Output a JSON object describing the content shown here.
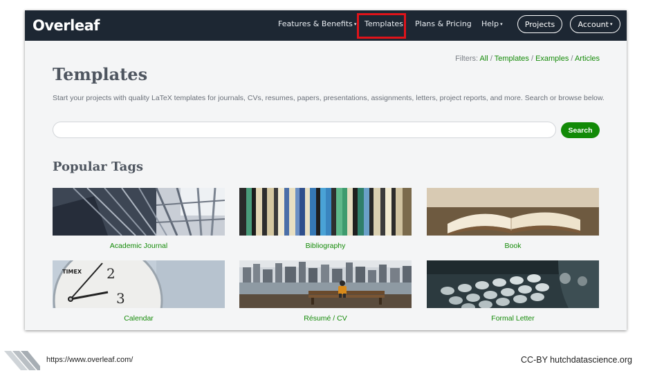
{
  "nav": {
    "logo": "Overleaf",
    "features_label": "Features & Benefits",
    "templates_label": "Templates",
    "plans_label": "Plans & Pricing",
    "help_label": "Help",
    "projects_label": "Projects",
    "account_label": "Account",
    "caret": "▾"
  },
  "filters": {
    "label": "Filters:",
    "all": "All",
    "templates": "Templates",
    "examples": "Examples",
    "articles": "Articles",
    "sep": "/"
  },
  "page": {
    "title": "Templates",
    "description": "Start your projects with quality LaTeX templates for journals, CVs, resumes, papers, presentations, assignments, letters, project reports, and more. Search or browse below."
  },
  "search": {
    "placeholder": "",
    "button_label": "Search"
  },
  "popular": {
    "title": "Popular Tags",
    "tags": [
      {
        "label": "Academic Journal",
        "icon": "library-stairs-photo"
      },
      {
        "label": "Bibliography",
        "icon": "bookshelf-photo"
      },
      {
        "label": "Book",
        "icon": "open-book-photo"
      },
      {
        "label": "Calendar",
        "icon": "clock-photo"
      },
      {
        "label": "Résumé / CV",
        "icon": "city-bench-photo"
      },
      {
        "label": "Formal Letter",
        "icon": "typewriter-photo"
      }
    ]
  },
  "footer": {
    "url": "https://www.overleaf.com/",
    "credit": "CC-BY hutchdatascience.org"
  },
  "colors": {
    "nav_bg": "#1d2733",
    "accent_green": "#138a07",
    "highlight_red": "#e0131a"
  }
}
